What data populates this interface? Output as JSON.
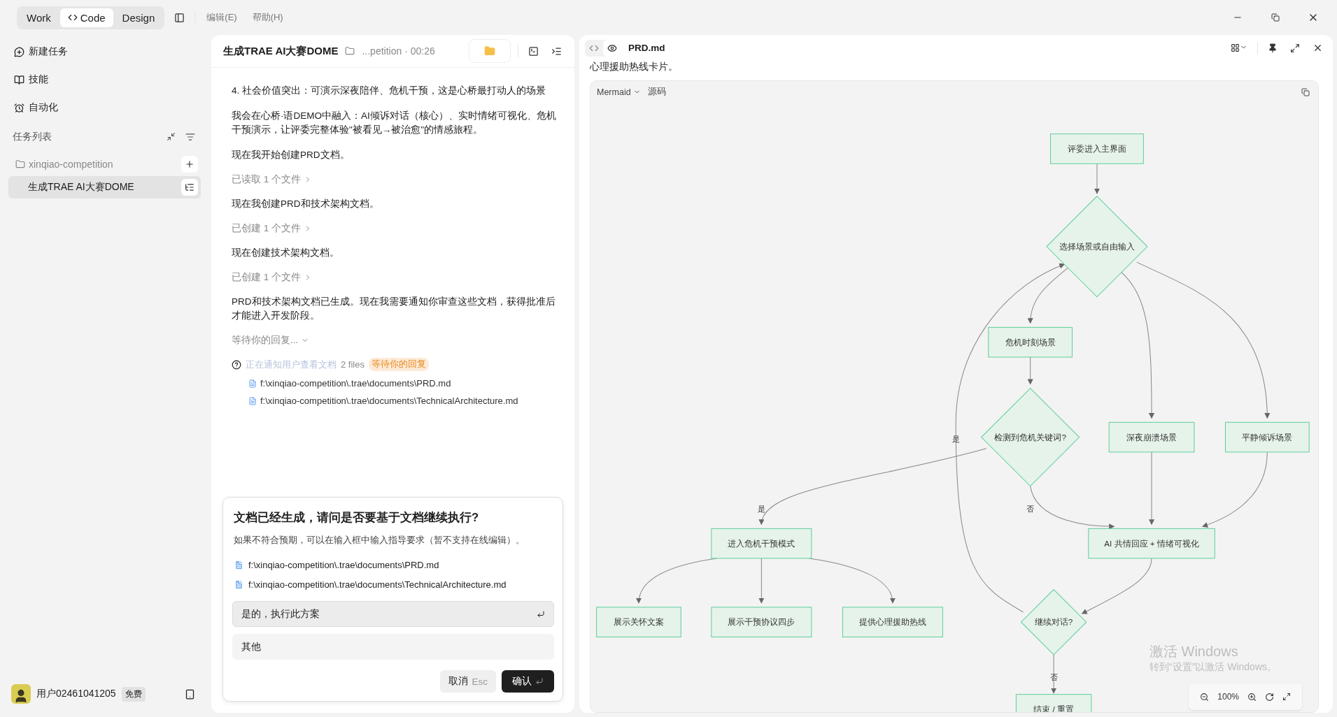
{
  "top_bar": {
    "modes": [
      {
        "label": "Work",
        "selected": false
      },
      {
        "label": "Code",
        "selected": true
      },
      {
        "label": "Design",
        "selected": false
      }
    ],
    "menu": [
      "编辑(E)",
      "帮助(H)"
    ]
  },
  "sidebar": {
    "nav": [
      "新建任务",
      "技能",
      "自动化"
    ],
    "task_list_title": "任务列表",
    "project": "xinqiao-competition",
    "tasks": [
      {
        "label": "生成TRAE AI大赛DOME",
        "selected": true
      }
    ],
    "user": {
      "name": "用户02461041205",
      "plan": "免费"
    }
  },
  "chat": {
    "title": "生成TRAE AI大赛DOME",
    "path": "...petition · 00:26",
    "messages": [
      {
        "kind": "text",
        "text": "4. 社会价值突出：可演示深夜陪伴、危机干预，这是心桥最打动人的场景"
      },
      {
        "kind": "text",
        "text": "我会在心桥·语DEMO中融入：AI倾诉对话（核心）、实时情绪可视化、危机干预演示，让评委完整体验\"被看见→被治愈\"的情感旅程。"
      },
      {
        "kind": "text",
        "text": "现在我开始创建PRD文档。"
      },
      {
        "kind": "step",
        "text": "已读取 1 个文件"
      },
      {
        "kind": "text",
        "text": "现在我创建PRD和技术架构文档。"
      },
      {
        "kind": "step",
        "text": "已创建 1 个文件"
      },
      {
        "kind": "text",
        "text": "现在创建技术架构文档。"
      },
      {
        "kind": "step",
        "text": "已创建 1 个文件"
      },
      {
        "kind": "text",
        "text": "PRD和技术架构文档已生成。现在我需要通知你审查这些文档，获得批准后才能进入开发阶段。"
      },
      {
        "kind": "waiting",
        "text": "等待你的回复..."
      }
    ],
    "tool": {
      "text": "正在通知用户查看文档",
      "count": "2 files",
      "badge": "等待你的回复",
      "files": [
        "f:\\xinqiao-competition\\.trae\\documents\\PRD.md",
        "f:\\xinqiao-competition\\.trae\\documents\\TechnicalArchitecture.md"
      ]
    },
    "dialog": {
      "title": "文档已经生成，请问是否要基于文档继续执行?",
      "hint": "如果不符合预期，可以在输入框中输入指导要求（暂不支持在线编辑）。",
      "files": [
        "f:\\xinqiao-competition\\.trae\\documents\\PRD.md",
        "f:\\xinqiao-competition\\.trae\\documents\\TechnicalArchitecture.md"
      ],
      "options": [
        {
          "label": "是的，执行此方案",
          "selected": true
        },
        {
          "label": "其他",
          "selected": false
        }
      ],
      "cancel": "取消",
      "cancel_key": "Esc",
      "confirm": "确认"
    }
  },
  "preview": {
    "file": "PRD.md",
    "view_modes": [
      {
        "kind": "code",
        "selected": false
      },
      {
        "kind": "preview",
        "selected": true
      }
    ],
    "text": "心理援助热线卡片。",
    "code_block": {
      "language": "Mermaid",
      "tab": "源码"
    },
    "flowchart": {
      "nodes": [
        {
          "kind": "rect",
          "label": "评委进入主界面"
        },
        {
          "kind": "diamond",
          "label": "选择场景或自由输入"
        },
        {
          "kind": "rect",
          "label": "危机时刻场景"
        },
        {
          "kind": "diamond",
          "label": "检测到危机关键词?"
        },
        {
          "kind": "rect",
          "label": "深夜崩溃场景"
        },
        {
          "kind": "rect",
          "label": "平静倾诉场景"
        },
        {
          "kind": "rect",
          "label": "进入危机干预模式"
        },
        {
          "kind": "rect",
          "label": "AI 共情回应 + 情绪可视化"
        },
        {
          "kind": "rect",
          "label": "展示关怀文案"
        },
        {
          "kind": "rect",
          "label": "展示干预协议四步"
        },
        {
          "kind": "rect",
          "label": "提供心理援助热线"
        },
        {
          "kind": "diamond",
          "label": "继续对话?"
        },
        {
          "kind": "rect",
          "label": "结束 / 重置"
        }
      ],
      "edge_labels": [
        "是",
        "是",
        "否",
        "否"
      ]
    },
    "zoom": "100%"
  },
  "os_notice": {
    "title": "激活 Windows",
    "text": "转到“设置”以激活 Windows。"
  }
}
